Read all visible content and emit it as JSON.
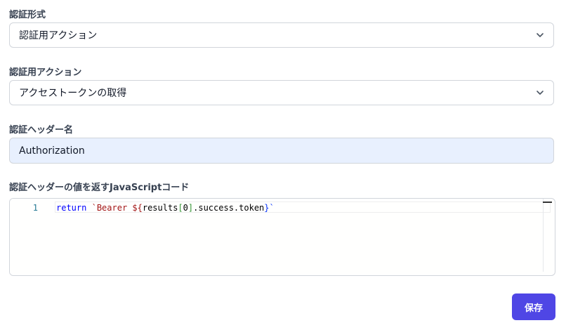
{
  "form": {
    "auth_type": {
      "label": "認証形式",
      "selected": "認証用アクション",
      "icon": "chevron-down-icon"
    },
    "auth_action": {
      "label": "認証用アクション",
      "selected": "アクセストークンの取得",
      "icon": "chevron-down-icon"
    },
    "auth_header_name": {
      "label": "認証ヘッダー名",
      "value": "Authorization"
    },
    "auth_header_js": {
      "label": "認証ヘッダーの値を返すJavaScriptコード",
      "line_number": "1",
      "code": {
        "keyword": "return",
        "template_start": "`Bearer ${",
        "expr_part1": "results",
        "bracket_open": "[",
        "index": "0",
        "bracket_close": "]",
        "expr_part2": ".success.token",
        "template_end": "}`"
      }
    }
  },
  "actions": {
    "save_label": "保存"
  },
  "colors": {
    "primary": "#4f46e5",
    "autofill_bg": "#e8f0fe",
    "border": "#d1d5db"
  }
}
